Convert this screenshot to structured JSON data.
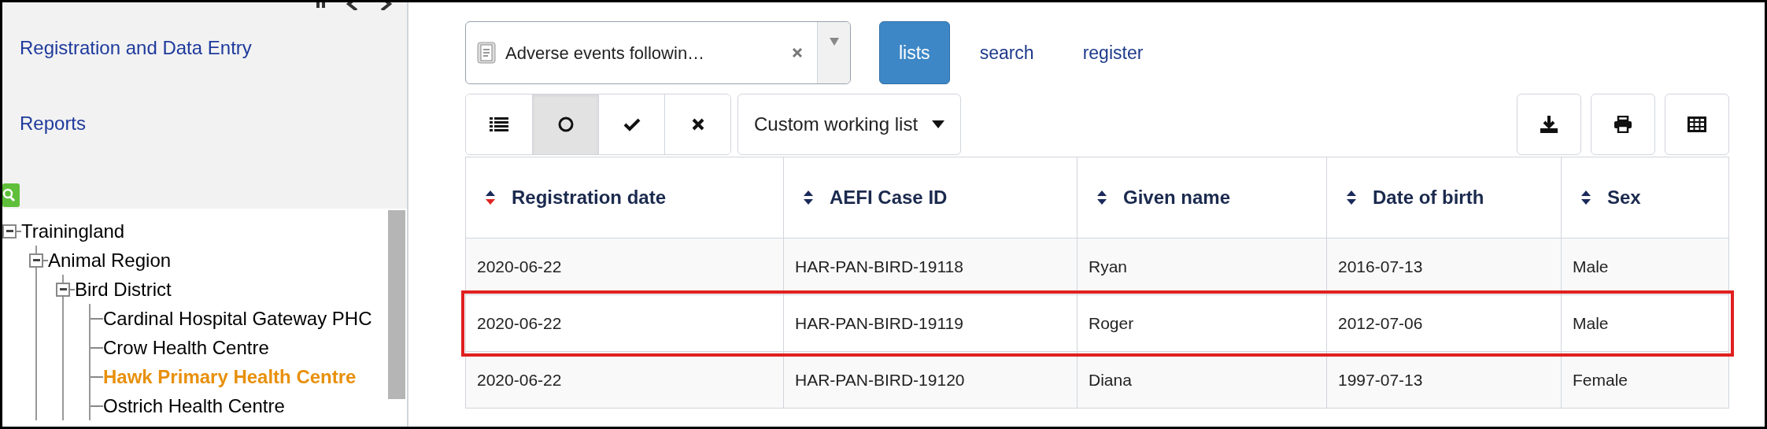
{
  "sidebar": {
    "links": [
      {
        "label": "Registration and Data Entry"
      },
      {
        "label": "Reports"
      }
    ],
    "tree": [
      {
        "label": "Trainingland",
        "expanded": true,
        "selected": false,
        "children": [
          {
            "label": "Animal Region",
            "expanded": true,
            "selected": false,
            "children": [
              {
                "label": "Bird District",
                "expanded": true,
                "selected": false,
                "children": [
                  {
                    "label": "Cardinal Hospital Gateway PHC",
                    "selected": false
                  },
                  {
                    "label": "Crow Health Centre",
                    "selected": false
                  },
                  {
                    "label": "Hawk Primary Health Centre",
                    "selected": true
                  },
                  {
                    "label": "Ostrich Health Centre",
                    "selected": false
                  }
                ]
              }
            ]
          }
        ]
      }
    ]
  },
  "program_selector": {
    "value": "Adverse events followin…"
  },
  "tabs": [
    {
      "label": "lists",
      "selected": true
    },
    {
      "label": "search",
      "selected": false
    },
    {
      "label": "register",
      "selected": false
    }
  ],
  "view_filters": [
    {
      "kind": "list",
      "selected": false
    },
    {
      "kind": "circle",
      "selected": true
    },
    {
      "kind": "check",
      "selected": false
    },
    {
      "kind": "cross",
      "selected": false
    }
  ],
  "working_list": {
    "label": "Custom working list"
  },
  "actions": [
    {
      "kind": "download"
    },
    {
      "kind": "print"
    },
    {
      "kind": "grid"
    }
  ],
  "table": {
    "columns": [
      {
        "label": "Registration date",
        "sorted": true
      },
      {
        "label": "AEFI Case ID",
        "sorted": false
      },
      {
        "label": "Given name",
        "sorted": false
      },
      {
        "label": "Date of birth",
        "sorted": false
      },
      {
        "label": "Sex",
        "sorted": false
      }
    ],
    "rows": [
      {
        "highlighted": false,
        "cells": [
          "2020-06-22",
          "HAR-PAN-BIRD-19118",
          "Ryan",
          "2016-07-13",
          "Male"
        ]
      },
      {
        "highlighted": true,
        "cells": [
          "2020-06-22",
          "HAR-PAN-BIRD-19119",
          "Roger",
          "2012-07-06",
          "Male"
        ]
      },
      {
        "highlighted": false,
        "cells": [
          "2020-06-22",
          "HAR-PAN-BIRD-19120",
          "Diana",
          "1997-07-13",
          "Female"
        ]
      }
    ]
  }
}
